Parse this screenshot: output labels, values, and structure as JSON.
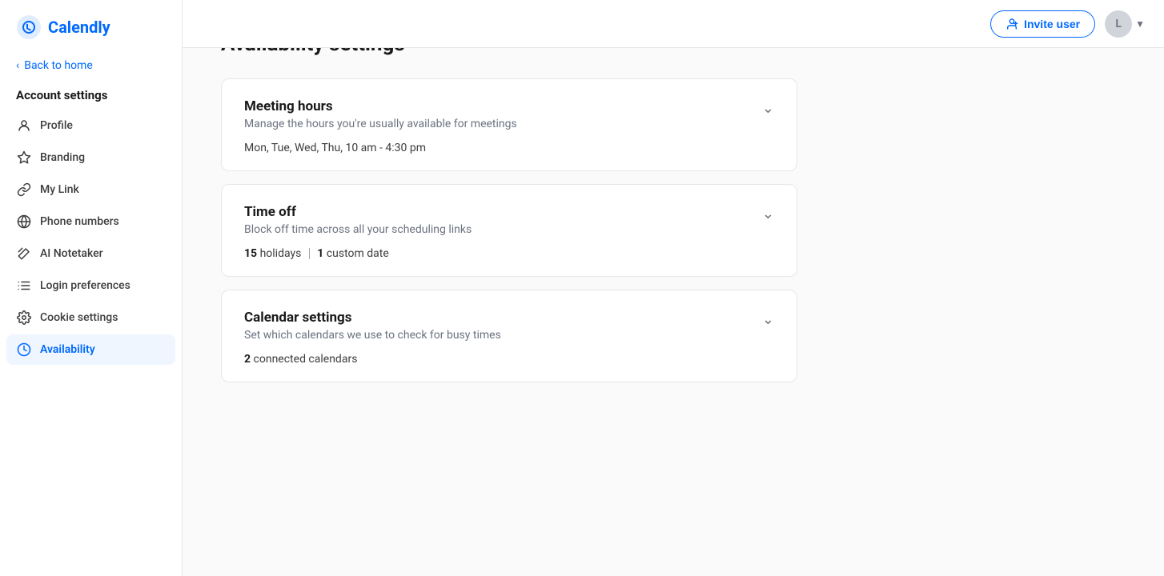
{
  "logo": {
    "text": "Calendly"
  },
  "sidebar": {
    "back_label": "Back to home",
    "section_title": "Account settings",
    "nav_items": [
      {
        "id": "profile",
        "label": "Profile",
        "icon": "person"
      },
      {
        "id": "branding",
        "label": "Branding",
        "icon": "star"
      },
      {
        "id": "my-link",
        "label": "My Link",
        "icon": "link"
      },
      {
        "id": "phone-numbers",
        "label": "Phone numbers",
        "icon": "globe"
      },
      {
        "id": "ai-notetaker",
        "label": "AI Notetaker",
        "icon": "wand"
      },
      {
        "id": "login-preferences",
        "label": "Login preferences",
        "icon": "list"
      },
      {
        "id": "cookie-settings",
        "label": "Cookie settings",
        "icon": "gear"
      },
      {
        "id": "availability",
        "label": "Availability",
        "icon": "clock",
        "active": true
      }
    ]
  },
  "topbar": {
    "invite_label": "Invite user",
    "user_initial": "L"
  },
  "main": {
    "page_title": "Availability settings",
    "cards": [
      {
        "id": "meeting-hours",
        "title": "Meeting hours",
        "subtitle": "Manage the hours you're usually available for meetings",
        "detail": "Mon, Tue, Wed, Thu, 10 am - 4:30 pm"
      },
      {
        "id": "time-off",
        "title": "Time off",
        "subtitle": "Block off time across all your scheduling links",
        "detail_prefix": "",
        "detail_num1": "15",
        "detail_label1": "holidays",
        "detail_num2": "1",
        "detail_label2": "custom date"
      },
      {
        "id": "calendar-settings",
        "title": "Calendar settings",
        "subtitle": "Set which calendars we use to check for busy times",
        "detail_num": "2",
        "detail_label": "connected calendars"
      }
    ]
  }
}
